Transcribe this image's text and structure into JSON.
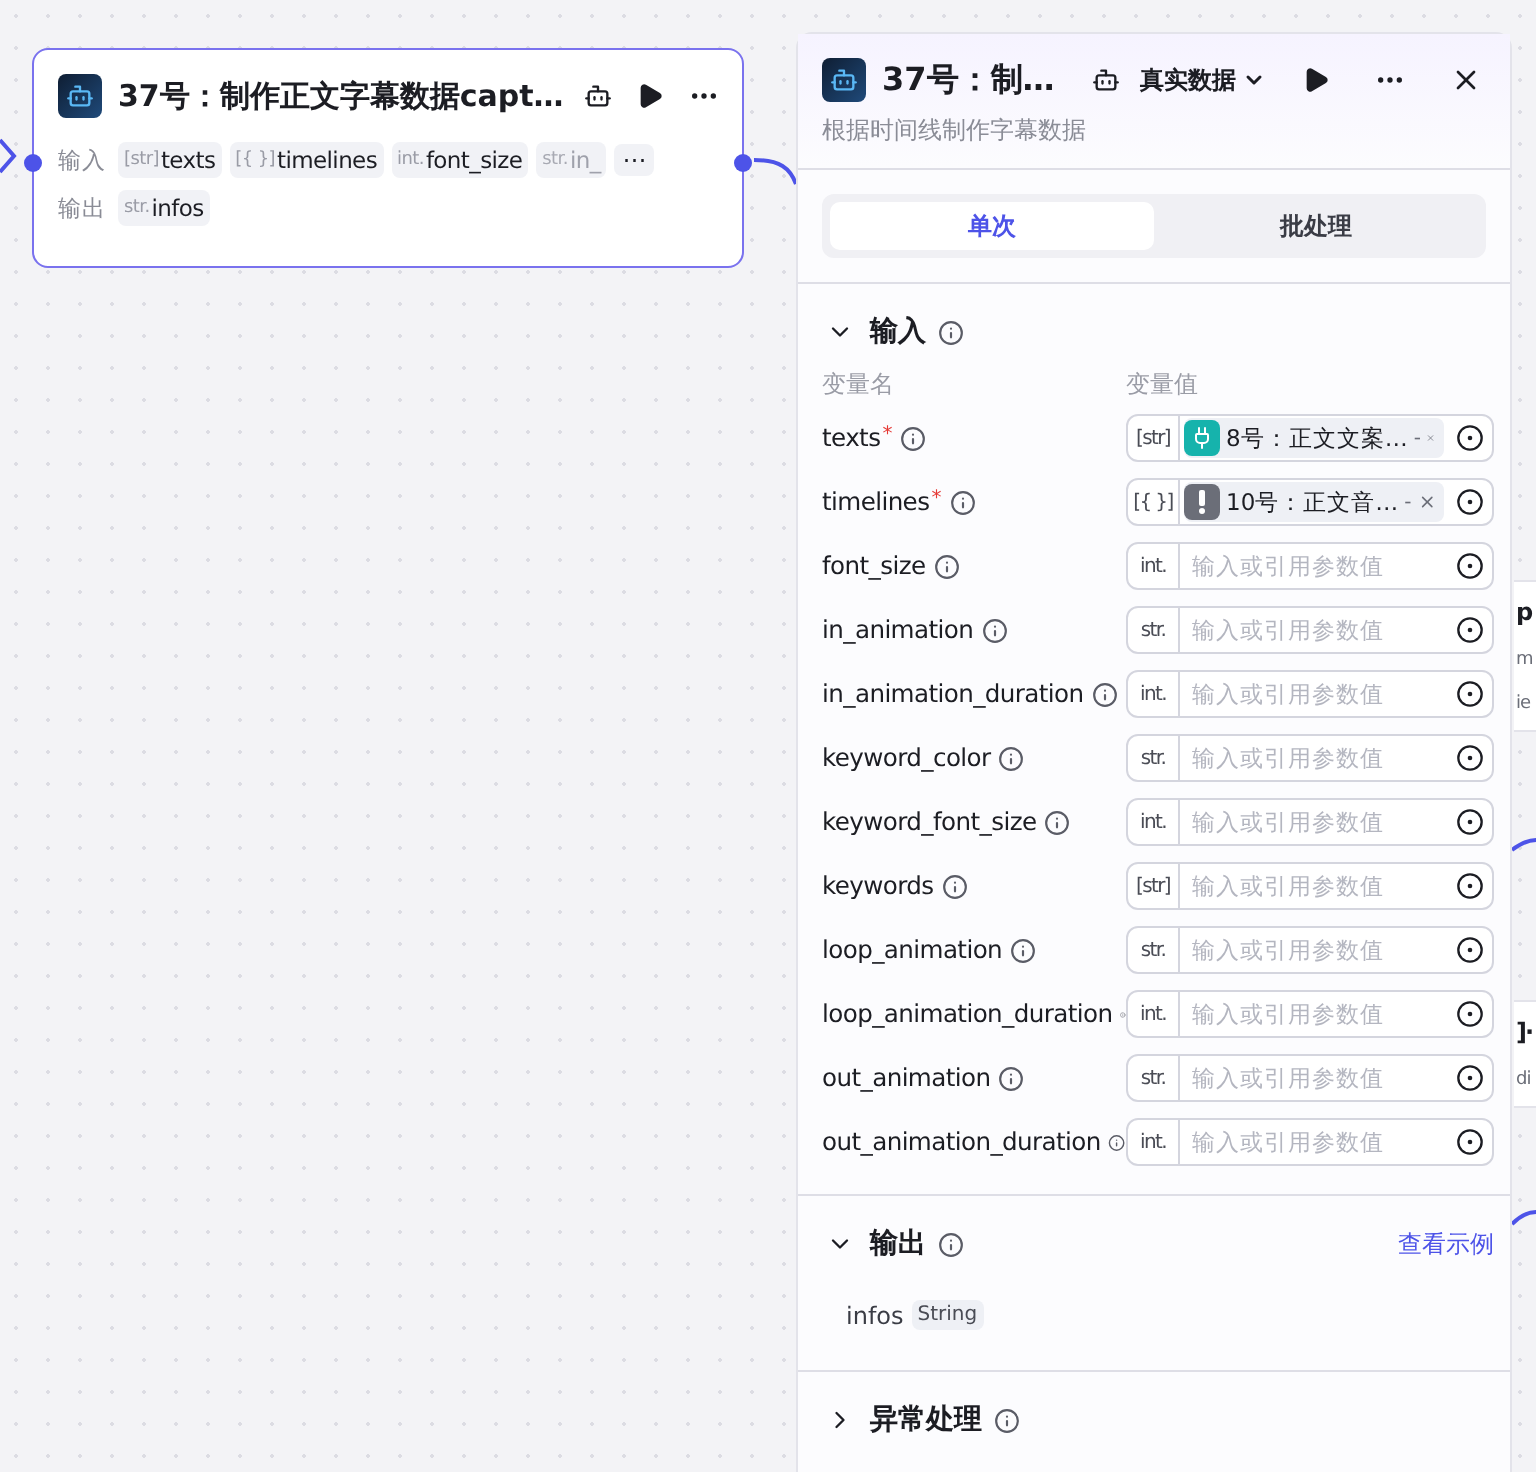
{
  "node": {
    "title": "37号：制作正文字幕数据capt…",
    "inputs_label": "输入",
    "outputs_label": "输出",
    "inputs": [
      {
        "type": "[str]",
        "name": "texts",
        "faded": false
      },
      {
        "type": "[{ }]",
        "name": "timelines",
        "faded": false
      },
      {
        "type": "int.",
        "name": "font_size",
        "faded": false
      },
      {
        "type": "str.",
        "name": "in_",
        "faded": true
      }
    ],
    "more": "⋯",
    "outputs": [
      {
        "type": "str.",
        "name": "infos"
      }
    ]
  },
  "background_nodes": [
    {
      "title": "p",
      "lines": [
        "m",
        "ie"
      ]
    },
    {
      "title": "]·",
      "lines": [
        "di"
      ]
    }
  ],
  "panel": {
    "title": "37号：制…",
    "data_mode": "真实数据",
    "description": "根据时间线制作字幕数据",
    "tabs": [
      {
        "label": "单次",
        "selected": true
      },
      {
        "label": "批处理",
        "selected": false
      }
    ],
    "input_section": {
      "title": "输入",
      "expanded": true,
      "col_name": "变量名",
      "col_value": "变量值",
      "required_mark": "*",
      "ref_separator": "-",
      "rows": [
        {
          "name": "texts",
          "required": true,
          "type": "[str]",
          "ref": {
            "label": "8号：正文文案…",
            "color": "#16b3ac",
            "kind": "plugin"
          }
        },
        {
          "name": "timelines",
          "required": true,
          "type": "[{ }]",
          "ref": {
            "label": "10号：正文音…",
            "color": "#6b6e78",
            "kind": "alert"
          }
        },
        {
          "name": "font_size",
          "required": false,
          "type": "int.",
          "placeholder": "输入或引用参数值"
        },
        {
          "name": "in_animation",
          "required": false,
          "type": "str.",
          "placeholder": "输入或引用参数值"
        },
        {
          "name": "in_animation_duration",
          "required": false,
          "type": "int.",
          "placeholder": "输入或引用参数值"
        },
        {
          "name": "keyword_color",
          "required": false,
          "type": "str.",
          "placeholder": "输入或引用参数值"
        },
        {
          "name": "keyword_font_size",
          "required": false,
          "type": "int.",
          "placeholder": "输入或引用参数值"
        },
        {
          "name": "keywords",
          "required": false,
          "type": "[str]",
          "placeholder": "输入或引用参数值"
        },
        {
          "name": "loop_animation",
          "required": false,
          "type": "str.",
          "placeholder": "输入或引用参数值"
        },
        {
          "name": "loop_animation_duration",
          "required": false,
          "type": "int.",
          "placeholder": "输入或引用参数值"
        },
        {
          "name": "out_animation",
          "required": false,
          "type": "str.",
          "placeholder": "输入或引用参数值"
        },
        {
          "name": "out_animation_duration",
          "required": false,
          "type": "int.",
          "placeholder": "输入或引用参数值"
        }
      ]
    },
    "output_section": {
      "title": "输出",
      "expanded": true,
      "link": "查看示例",
      "outputs": [
        {
          "name": "infos",
          "type": "String"
        }
      ]
    },
    "error_section": {
      "title": "异常处理",
      "expanded": false
    }
  }
}
